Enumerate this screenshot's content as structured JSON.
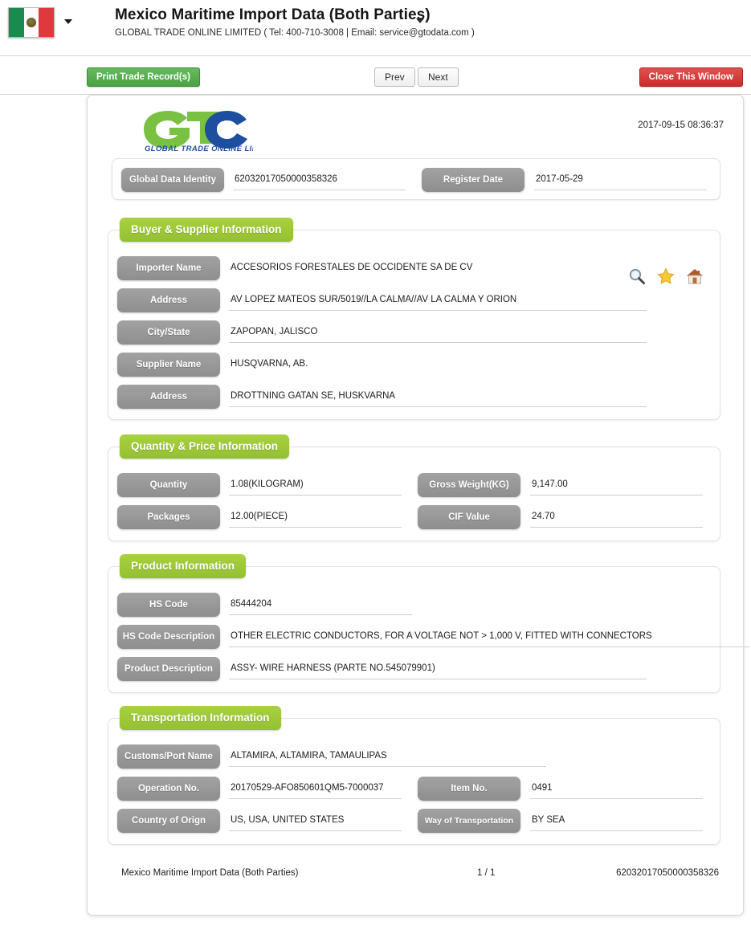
{
  "header": {
    "flag": "mexico-flag",
    "title": "Mexico Maritime Import Data (Both Parties)",
    "subtitle": "GLOBAL TRADE ONLINE LIMITED ( Tel: 400-710-3008 | Email: service@gtodata.com )"
  },
  "toolbar": {
    "print_label": "Print Trade Record(s)",
    "prev_label": "Prev",
    "next_label": "Next",
    "close_label": "Close This Window"
  },
  "document": {
    "logo_text_top": "GTO",
    "logo_text_bottom": "GLOBAL TRADE  ONLINE LIMITED",
    "timestamp": "2017-09-15 08:36:37",
    "identity": {
      "label": "Global Data Identity",
      "value": "62032017050000358326"
    },
    "register_date": {
      "label": "Register Date",
      "value": "2017-05-29"
    },
    "sections": [
      {
        "title": "Buyer & Supplier Information",
        "icons": [
          "search-icon",
          "star-icon",
          "home-icon"
        ],
        "fields": [
          {
            "label": "Importer Name",
            "value": "ACCESORIOS FORESTALES DE OCCIDENTE SA DE CV"
          },
          {
            "label": "Address",
            "value": "AV LOPEZ MATEOS SUR/5019//LA CALMA//AV LA CALMA Y ORION"
          },
          {
            "label": "City/State",
            "value": "ZAPOPAN, JALISCO"
          },
          {
            "label": "Supplier Name",
            "value": "HUSQVARNA, AB."
          },
          {
            "label": "Address",
            "value": "DROTTNING GATAN SE, HUSKVARNA"
          }
        ]
      },
      {
        "title": "Quantity & Price Information",
        "fields": [
          {
            "label": "Quantity",
            "value": "1.08(KILOGRAM)"
          },
          {
            "label": "Gross Weight(KG)",
            "value": "9,147.00"
          },
          {
            "label": "Packages",
            "value": "12.00(PIECE)"
          },
          {
            "label": "CIF Value",
            "value": "24.70"
          }
        ]
      },
      {
        "title": "Product Information",
        "fields": [
          {
            "label": "HS Code",
            "value": "85444204"
          },
          {
            "label": "HS Code Description",
            "value": "OTHER ELECTRIC CONDUCTORS, FOR A VOLTAGE NOT > 1,000 V, FITTED WITH CONNECTORS"
          },
          {
            "label": "Product Description",
            "value": "ASSY- WIRE HARNESS (PARTE NO.545079901)"
          }
        ]
      },
      {
        "title": "Transportation Information",
        "fields": [
          {
            "label": "Customs/Port Name",
            "value": "ALTAMIRA, ALTAMIRA, TAMAULIPAS"
          },
          {
            "label": "Operation No.",
            "value": "20170529-AFO850601QM5-7000037"
          },
          {
            "label": "Item No.",
            "value": "0491"
          },
          {
            "label": "Country of Orign",
            "value": "US, USA, UNITED STATES"
          },
          {
            "label": "Way of Transportation",
            "value": "BY SEA"
          }
        ]
      }
    ],
    "footer": {
      "left": "Mexico Maritime Import Data (Both Parties)",
      "middle": "1 / 1",
      "right": "62032017050000358326"
    }
  },
  "colors": {
    "section_green": "#9ac935",
    "button_green": "#4aa244",
    "button_red": "#cb2b2b",
    "label_gray": "#949494",
    "logo_green": "#7ac143",
    "logo_blue": "#1d4f9e"
  }
}
